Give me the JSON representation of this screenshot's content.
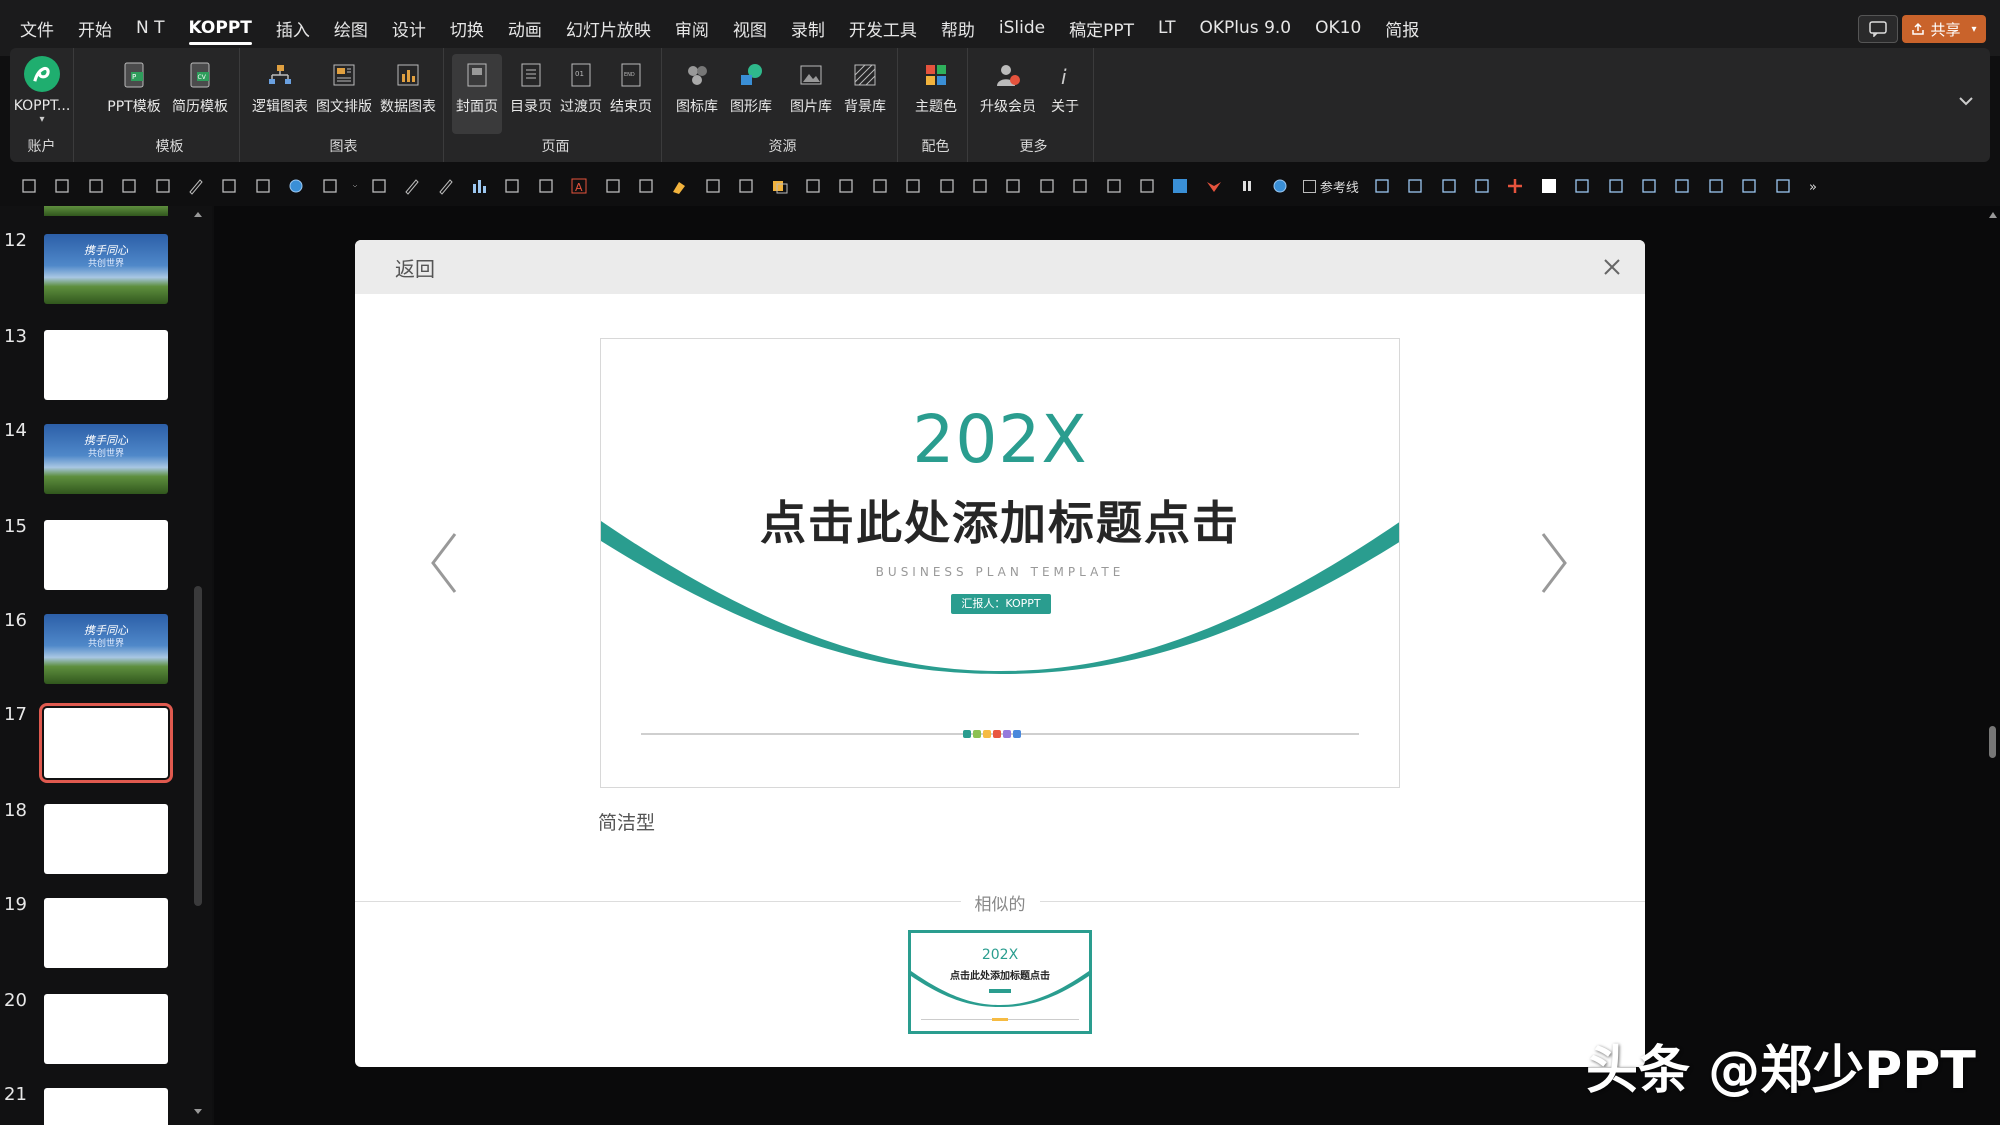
{
  "menubar": {
    "items": [
      "文件",
      "开始",
      "N T",
      "KOPPT",
      "插入",
      "绘图",
      "设计",
      "切换",
      "动画",
      "幻灯片放映",
      "审阅",
      "视图",
      "录制",
      "开发工具",
      "帮助",
      "iSlide",
      "稿定PPT",
      "LT",
      "OKPlus 9.0",
      "OK10",
      "简报"
    ],
    "share_label": "共享"
  },
  "ribbon": {
    "account": {
      "label": "KOPPT...",
      "group": "账户"
    },
    "templates": {
      "group": "模板",
      "buttons": [
        "PPT模板",
        "简历模板"
      ]
    },
    "charts": {
      "group": "图表",
      "buttons": [
        "逻辑图表",
        "图文排版",
        "数据图表"
      ]
    },
    "pages": {
      "group": "页面",
      "buttons": [
        "封面页",
        "目录页",
        "过渡页",
        "结束页"
      ]
    },
    "resources": {
      "group": "资源",
      "buttons": [
        "图标库",
        "图形库",
        "图片库",
        "背景库"
      ]
    },
    "colors": {
      "group": "配色",
      "buttons": [
        "主题色"
      ]
    },
    "more": {
      "group": "更多",
      "buttons": [
        "升级会员",
        "关于"
      ]
    }
  },
  "quick_toolbar": {
    "guide_label": "参考线"
  },
  "slides": [
    {
      "num": "12",
      "style": "blue",
      "text": "携手同心",
      "text2": "共创世界"
    },
    {
      "num": "13",
      "style": "white"
    },
    {
      "num": "14",
      "style": "blue",
      "text": "携手同心",
      "text2": "共创世界"
    },
    {
      "num": "15",
      "style": "white"
    },
    {
      "num": "16",
      "style": "blue",
      "text": "携手同心",
      "text2": "共创世界"
    },
    {
      "num": "17",
      "style": "white",
      "selected": true
    },
    {
      "num": "18",
      "style": "white"
    },
    {
      "num": "19",
      "style": "white"
    },
    {
      "num": "20",
      "style": "white"
    },
    {
      "num": "21",
      "style": "white"
    }
  ],
  "dialog": {
    "back_label": "返回",
    "preview": {
      "year": "202X",
      "title": "点击此处添加标题点击",
      "subtitle": "BUSINESS PLAN TEMPLATE",
      "badge": "汇报人：KOPPT",
      "accent": "#2a9d8f",
      "dot_colors": [
        "#2a9d8f",
        "#8cc152",
        "#f6bb42",
        "#e9573f",
        "#967adc",
        "#4a89dc"
      ]
    },
    "caption": "简洁型",
    "similar_label": "相似的",
    "similar_thumb": {
      "year": "202X",
      "title": "点击此处添加标题点击"
    }
  },
  "watermark": "头条 @郑少PPT"
}
